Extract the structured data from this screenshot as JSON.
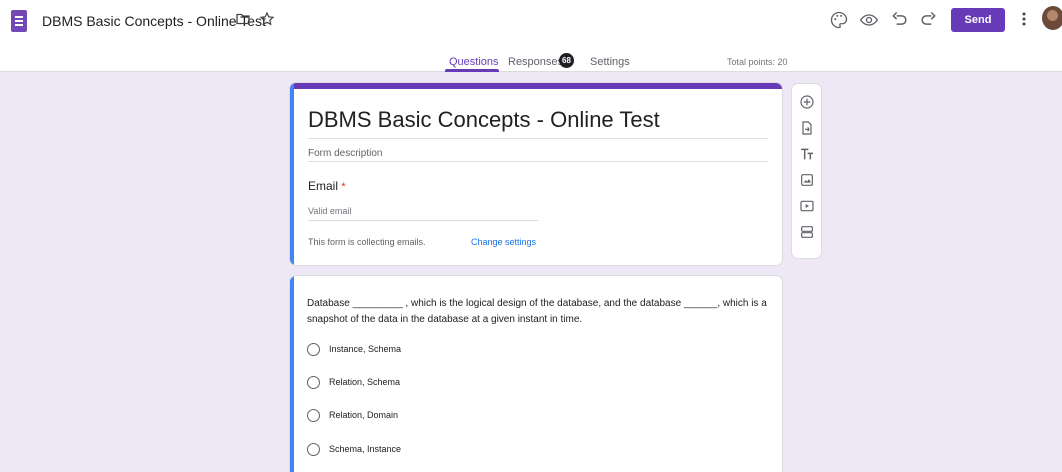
{
  "header": {
    "doc_title": "DBMS Basic Concepts - Online Test",
    "send_label": "Send",
    "icons": [
      "forms-app-icon",
      "folder-icon",
      "star-icon",
      "palette-icon",
      "preview-eye-icon",
      "undo-icon",
      "redo-icon",
      "more-vert-icon",
      "avatar"
    ]
  },
  "tabs": {
    "questions": "Questions",
    "responses": "Responses",
    "responses_count": "68",
    "settings": "Settings",
    "total_points": "Total points: 20"
  },
  "title_card": {
    "title": "DBMS Basic Concepts - Online Test",
    "description_placeholder": "Form description",
    "email_label": "Email",
    "required_mark": "*",
    "email_placeholder": "Valid email",
    "collecting_note": "This form is collecting emails.",
    "change_settings_link": "Change settings"
  },
  "question": {
    "text": "Database _________ , which is the logical design of the database, and the database ______, which is a snapshot of the data in the database at a given instant in time.",
    "options": [
      "Instance, Schema",
      "Relation, Schema",
      "Relation, Domain",
      "Schema, Instance"
    ]
  },
  "toolbar": {
    "tools": [
      "add-question-icon",
      "import-questions-icon",
      "add-title-icon",
      "add-image-icon",
      "add-video-icon",
      "add-section-icon"
    ]
  },
  "colors": {
    "accent": "#673ab7",
    "background": "#ede7f6",
    "focus_bar": "#4285f4",
    "link": "#1a73e8",
    "required": "#d93025"
  }
}
